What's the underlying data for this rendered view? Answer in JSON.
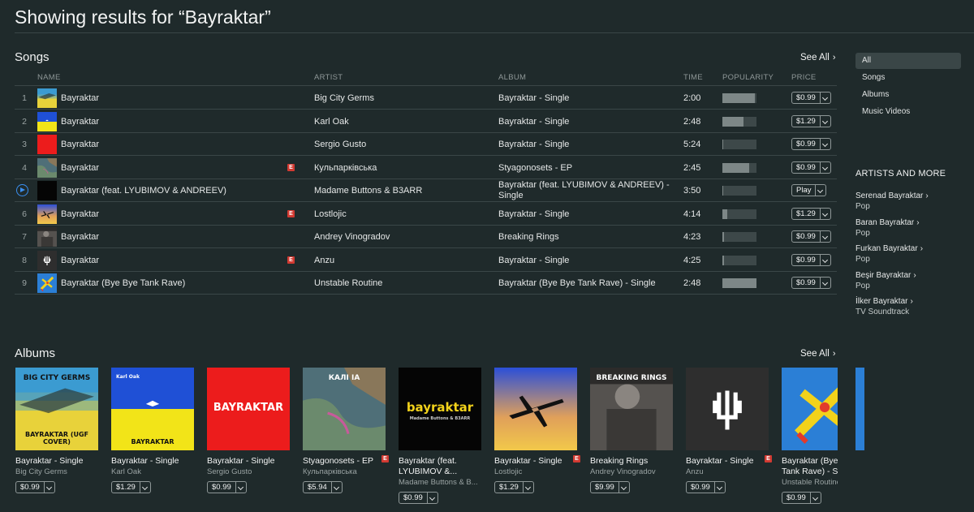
{
  "page_title": "Showing results for “Bayraktar”",
  "songs": {
    "heading": "Songs",
    "see_all": "See All",
    "columns": {
      "name": "NAME",
      "artist": "ARTIST",
      "album": "ALBUM",
      "time": "TIME",
      "popularity": "POPULARITY",
      "price": "PRICE"
    },
    "rows": [
      {
        "num": "1",
        "name": "Bayraktar",
        "artist": "Big City Germs",
        "album": "Bayraktar - Single",
        "time": "2:00",
        "popularity": 0.95,
        "price": "$0.99",
        "explicit": false
      },
      {
        "num": "2",
        "name": "Bayraktar",
        "artist": "Karl Oak",
        "album": "Bayraktar - Single",
        "time": "2:48",
        "popularity": 0.62,
        "price": "$1.29",
        "explicit": false
      },
      {
        "num": "3",
        "name": "Bayraktar",
        "artist": "Sergio Gusto",
        "album": "Bayraktar - Single",
        "time": "5:24",
        "popularity": 0.02,
        "price": "$0.99",
        "explicit": false
      },
      {
        "num": "4",
        "name": "Bayraktar",
        "artist": "Кульпарківська",
        "album": "Styagonosets - EP",
        "time": "2:45",
        "popularity": 0.78,
        "price": "$0.99",
        "explicit": true
      },
      {
        "num": "",
        "name": "Bayraktar (feat. LYUBIMOV & ANDREEV)",
        "artist": "Madame Buttons & B3ARR",
        "album": "Bayraktar (feat. LYUBIMOV & ANDREEV) - Single",
        "time": "3:50",
        "popularity": 0.02,
        "price": "Play",
        "explicit": false,
        "playing": true
      },
      {
        "num": "6",
        "name": "Bayraktar",
        "artist": "Lostlojic",
        "album": "Bayraktar - Single",
        "time": "4:14",
        "popularity": 0.15,
        "price": "$1.29",
        "explicit": true
      },
      {
        "num": "7",
        "name": "Bayraktar",
        "artist": "Andrey Vinogradov",
        "album": "Breaking Rings",
        "time": "4:23",
        "popularity": 0.04,
        "price": "$0.99",
        "explicit": false
      },
      {
        "num": "8",
        "name": "Bayraktar",
        "artist": "Anzu",
        "album": "Bayraktar - Single",
        "time": "4:25",
        "popularity": 0.04,
        "price": "$0.99",
        "explicit": true
      },
      {
        "num": "9",
        "name": "Bayraktar (Bye Bye Tank Rave)",
        "artist": "Unstable Routine",
        "album": "Bayraktar (Bye Bye Tank Rave) - Single",
        "time": "2:48",
        "popularity": 1.0,
        "price": "$0.99",
        "explicit": false
      }
    ]
  },
  "sidebar": {
    "filters": [
      "All",
      "Songs",
      "Albums",
      "Music Videos"
    ],
    "active_filter": "All",
    "artists_heading": "ARTISTS AND MORE",
    "artists": [
      {
        "name": "Serenad Bayraktar",
        "genre": "Pop"
      },
      {
        "name": "Baran Bayraktar",
        "genre": "Pop"
      },
      {
        "name": "Furkan Bayraktar",
        "genre": "Pop"
      },
      {
        "name": "Beşir Bayraktar",
        "genre": "Pop"
      },
      {
        "name": "İlker Bayraktar",
        "genre": "TV Soundtrack"
      }
    ]
  },
  "albums": {
    "heading": "Albums",
    "see_all": "See All",
    "items": [
      {
        "title": "Bayraktar - Single",
        "artist": "Big City Germs",
        "price": "$0.99",
        "explicit": false,
        "cover_text_top": "BIG CITY GERMS",
        "cover_text_bottom": "BAYRAKTAR (UGF COVER)"
      },
      {
        "title": "Bayraktar - Single",
        "artist": "Karl Oak",
        "price": "$1.29",
        "explicit": false,
        "cover_text_top": "Karl Oak",
        "cover_text_bottom": "BAYRAKTAR"
      },
      {
        "title": "Bayraktar - Single",
        "artist": "Sergio Gusto",
        "price": "$0.99",
        "explicit": false,
        "cover_text_top": "BAYRAKTAR"
      },
      {
        "title": "Styagonosets - EP",
        "artist": "Кульпарківська",
        "price": "$5.94",
        "explicit": true,
        "cover_text_top": "КАЛІ ІА"
      },
      {
        "title": "Bayraktar (feat. LYUBIMOV &...",
        "artist": "Madame Buttons & B...",
        "price": "$0.99",
        "explicit": false,
        "cover_text_top": "bayraktar",
        "cover_text_bottom": "Madame Buttons & B3ARR"
      },
      {
        "title": "Bayraktar - Single",
        "artist": "Lostlojic",
        "price": "$1.29",
        "explicit": true
      },
      {
        "title": "Breaking Rings",
        "artist": "Andrey Vinogradov",
        "price": "$9.99",
        "explicit": false,
        "cover_text_top": "BREAKING RINGS"
      },
      {
        "title": "Bayraktar - Single",
        "artist": "Anzu",
        "price": "$0.99",
        "explicit": true
      },
      {
        "title": "Bayraktar (Bye B...",
        "title_line2": "Tank Rave) - Sin...",
        "artist": "Unstable Routine",
        "price": "$0.99",
        "explicit": false
      }
    ]
  },
  "colors": {
    "background": "#1f2a2b",
    "explicit_badge": "#d23a32",
    "play_accent": "#3b8ff0"
  }
}
